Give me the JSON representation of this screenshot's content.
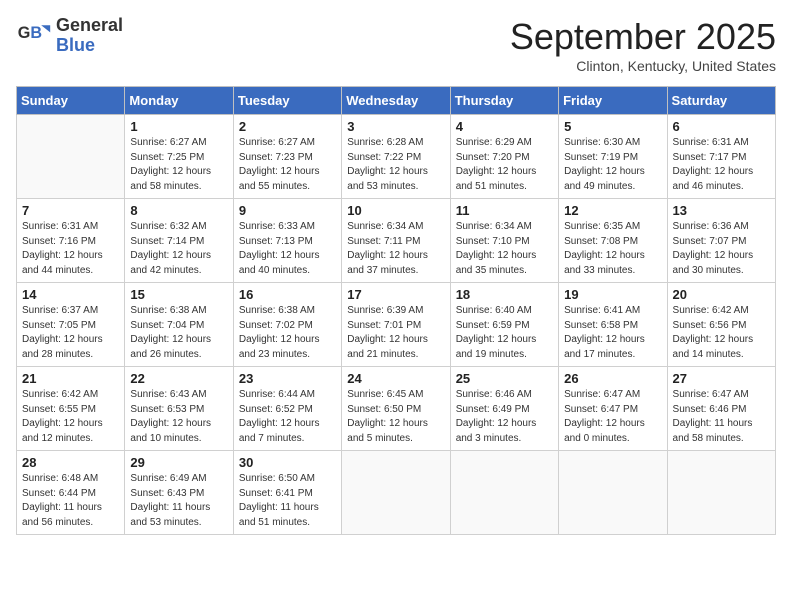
{
  "header": {
    "logo_line1": "General",
    "logo_line2": "Blue",
    "month": "September 2025",
    "location": "Clinton, Kentucky, United States"
  },
  "weekdays": [
    "Sunday",
    "Monday",
    "Tuesday",
    "Wednesday",
    "Thursday",
    "Friday",
    "Saturday"
  ],
  "weeks": [
    [
      {
        "day": "",
        "detail": ""
      },
      {
        "day": "1",
        "detail": "Sunrise: 6:27 AM\nSunset: 7:25 PM\nDaylight: 12 hours\nand 58 minutes."
      },
      {
        "day": "2",
        "detail": "Sunrise: 6:27 AM\nSunset: 7:23 PM\nDaylight: 12 hours\nand 55 minutes."
      },
      {
        "day": "3",
        "detail": "Sunrise: 6:28 AM\nSunset: 7:22 PM\nDaylight: 12 hours\nand 53 minutes."
      },
      {
        "day": "4",
        "detail": "Sunrise: 6:29 AM\nSunset: 7:20 PM\nDaylight: 12 hours\nand 51 minutes."
      },
      {
        "day": "5",
        "detail": "Sunrise: 6:30 AM\nSunset: 7:19 PM\nDaylight: 12 hours\nand 49 minutes."
      },
      {
        "day": "6",
        "detail": "Sunrise: 6:31 AM\nSunset: 7:17 PM\nDaylight: 12 hours\nand 46 minutes."
      }
    ],
    [
      {
        "day": "7",
        "detail": "Sunrise: 6:31 AM\nSunset: 7:16 PM\nDaylight: 12 hours\nand 44 minutes."
      },
      {
        "day": "8",
        "detail": "Sunrise: 6:32 AM\nSunset: 7:14 PM\nDaylight: 12 hours\nand 42 minutes."
      },
      {
        "day": "9",
        "detail": "Sunrise: 6:33 AM\nSunset: 7:13 PM\nDaylight: 12 hours\nand 40 minutes."
      },
      {
        "day": "10",
        "detail": "Sunrise: 6:34 AM\nSunset: 7:11 PM\nDaylight: 12 hours\nand 37 minutes."
      },
      {
        "day": "11",
        "detail": "Sunrise: 6:34 AM\nSunset: 7:10 PM\nDaylight: 12 hours\nand 35 minutes."
      },
      {
        "day": "12",
        "detail": "Sunrise: 6:35 AM\nSunset: 7:08 PM\nDaylight: 12 hours\nand 33 minutes."
      },
      {
        "day": "13",
        "detail": "Sunrise: 6:36 AM\nSunset: 7:07 PM\nDaylight: 12 hours\nand 30 minutes."
      }
    ],
    [
      {
        "day": "14",
        "detail": "Sunrise: 6:37 AM\nSunset: 7:05 PM\nDaylight: 12 hours\nand 28 minutes."
      },
      {
        "day": "15",
        "detail": "Sunrise: 6:38 AM\nSunset: 7:04 PM\nDaylight: 12 hours\nand 26 minutes."
      },
      {
        "day": "16",
        "detail": "Sunrise: 6:38 AM\nSunset: 7:02 PM\nDaylight: 12 hours\nand 23 minutes."
      },
      {
        "day": "17",
        "detail": "Sunrise: 6:39 AM\nSunset: 7:01 PM\nDaylight: 12 hours\nand 21 minutes."
      },
      {
        "day": "18",
        "detail": "Sunrise: 6:40 AM\nSunset: 6:59 PM\nDaylight: 12 hours\nand 19 minutes."
      },
      {
        "day": "19",
        "detail": "Sunrise: 6:41 AM\nSunset: 6:58 PM\nDaylight: 12 hours\nand 17 minutes."
      },
      {
        "day": "20",
        "detail": "Sunrise: 6:42 AM\nSunset: 6:56 PM\nDaylight: 12 hours\nand 14 minutes."
      }
    ],
    [
      {
        "day": "21",
        "detail": "Sunrise: 6:42 AM\nSunset: 6:55 PM\nDaylight: 12 hours\nand 12 minutes."
      },
      {
        "day": "22",
        "detail": "Sunrise: 6:43 AM\nSunset: 6:53 PM\nDaylight: 12 hours\nand 10 minutes."
      },
      {
        "day": "23",
        "detail": "Sunrise: 6:44 AM\nSunset: 6:52 PM\nDaylight: 12 hours\nand 7 minutes."
      },
      {
        "day": "24",
        "detail": "Sunrise: 6:45 AM\nSunset: 6:50 PM\nDaylight: 12 hours\nand 5 minutes."
      },
      {
        "day": "25",
        "detail": "Sunrise: 6:46 AM\nSunset: 6:49 PM\nDaylight: 12 hours\nand 3 minutes."
      },
      {
        "day": "26",
        "detail": "Sunrise: 6:47 AM\nSunset: 6:47 PM\nDaylight: 12 hours\nand 0 minutes."
      },
      {
        "day": "27",
        "detail": "Sunrise: 6:47 AM\nSunset: 6:46 PM\nDaylight: 11 hours\nand 58 minutes."
      }
    ],
    [
      {
        "day": "28",
        "detail": "Sunrise: 6:48 AM\nSunset: 6:44 PM\nDaylight: 11 hours\nand 56 minutes."
      },
      {
        "day": "29",
        "detail": "Sunrise: 6:49 AM\nSunset: 6:43 PM\nDaylight: 11 hours\nand 53 minutes."
      },
      {
        "day": "30",
        "detail": "Sunrise: 6:50 AM\nSunset: 6:41 PM\nDaylight: 11 hours\nand 51 minutes."
      },
      {
        "day": "",
        "detail": ""
      },
      {
        "day": "",
        "detail": ""
      },
      {
        "day": "",
        "detail": ""
      },
      {
        "day": "",
        "detail": ""
      }
    ]
  ]
}
